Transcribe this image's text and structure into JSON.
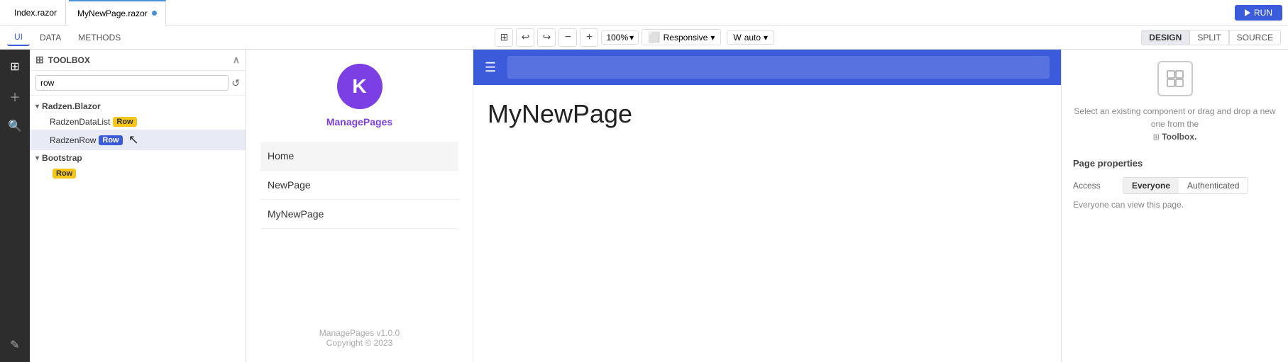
{
  "topbar": {
    "tab1_label": "Index.razor",
    "tab2_label": "MyNewPage.razor",
    "run_label": "RUN"
  },
  "subtoolbar": {
    "tab_ui": "UI",
    "tab_data": "DATA",
    "tab_methods": "METHODS",
    "zoom_value": "100%",
    "responsive_label": "Responsive",
    "w_label": "W",
    "auto_label": "auto",
    "design_label": "DESIGN",
    "split_label": "SPLIT",
    "source_label": "SOURCE"
  },
  "toolbox": {
    "title": "TOOLBOX",
    "search_placeholder": "row",
    "group1_label": "Radzen.Blazor",
    "item1_label": "RadzenDataList",
    "item1_badge": "Row",
    "item2_label": "RadzenRow",
    "item2_badge": "Row",
    "group2_label": "Bootstrap",
    "item3_label": "Row",
    "item3_badge": "Row"
  },
  "canvas": {
    "app_name": "ManagePages",
    "logo_letter": "K",
    "nav_home": "Home",
    "nav_newpage": "NewPage",
    "nav_mynewpage": "MyNewPage",
    "page_title": "MyNewPage",
    "footer_version": "ManagePages v1.0.0",
    "footer_copyright": "Copyright © 2023"
  },
  "right_panel": {
    "hint_text": "Select an existing component or drag and drop a new one from the",
    "hint_toolbox": "Toolbox.",
    "page_properties_title": "Page properties",
    "access_label": "Access",
    "everyone_label": "Everyone",
    "authenticated_label": "Authenticated",
    "access_hint": "Everyone can view this page."
  },
  "colors": {
    "accent": "#3b5bdb",
    "logo_bg": "#7b3fe4",
    "topbar_bg": "#3b5bdb"
  }
}
